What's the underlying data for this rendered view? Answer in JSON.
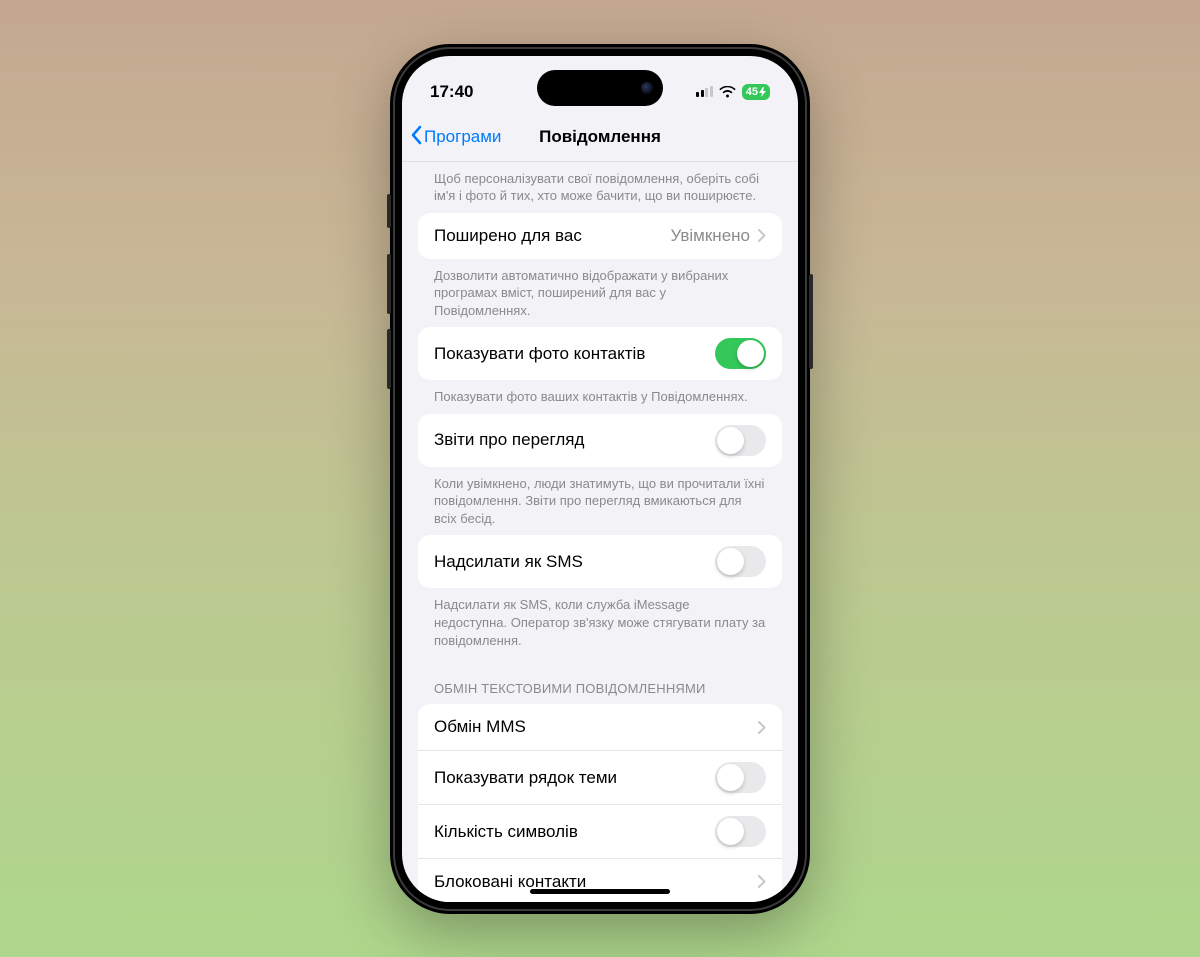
{
  "status": {
    "time": "17:40",
    "battery_text": "45"
  },
  "nav": {
    "back_label": "Програми",
    "title": "Повідомлення"
  },
  "intro_note": "Щоб персоналізувати свої повідомлення, оберіть собі ім'я і фото й тих, хто може бачити, що ви поширюєте.",
  "shared": {
    "label": "Поширено для вас",
    "value": "Увімкнено",
    "note": "Дозволити автоматично відображати у вибраних програмах вміст, поширений для вас у Повідомленнях."
  },
  "show_photos": {
    "label": "Показувати фото контактів",
    "on": true,
    "note": "Показувати фото ваших контактів у Повідомленнях."
  },
  "read_receipts": {
    "label": "Звіти про перегляд",
    "on": false,
    "note": "Коли увімкнено, люди знатимуть, що ви прочитали їхні повідомлення. Звіти про перегляд вмикаються для всіх бесід."
  },
  "send_sms": {
    "label": "Надсилати як SMS",
    "on": false,
    "note": "Надсилати як SMS, коли служба iMessage недоступна. Оператор зв'язку може стягувати плату за повідомлення."
  },
  "text_section": {
    "title": "ОБМІН ТЕКСТОВИМИ ПОВІДОМЛЕННЯМИ",
    "mms": "Обмін MMS",
    "subject": "Показувати рядок теми",
    "subject_on": false,
    "count": "Кількість символів",
    "count_on": false,
    "blocked": "Блоковані контакти"
  }
}
